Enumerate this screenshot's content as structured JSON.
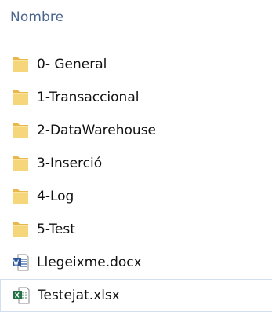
{
  "header": {
    "column_name": "Nombre"
  },
  "colors": {
    "header_text": "#4a6690",
    "folder_body": "#f6d67b",
    "folder_tab": "#e8b84a",
    "word_blue": "#2b579a",
    "excel_green": "#217346",
    "selection_border": "#d3dff0"
  },
  "files": [
    {
      "name": "0- General",
      "icon": "folder-icon",
      "selected": false
    },
    {
      "name": "1-Transaccional",
      "icon": "folder-icon",
      "selected": false
    },
    {
      "name": "2-DataWarehouse",
      "icon": "folder-icon",
      "selected": false
    },
    {
      "name": "3-Inserció",
      "icon": "folder-icon",
      "selected": false
    },
    {
      "name": "4-Log",
      "icon": "folder-icon",
      "selected": false
    },
    {
      "name": "5-Test",
      "icon": "folder-icon",
      "selected": false
    },
    {
      "name": "Llegeixme.docx",
      "icon": "word-document-icon",
      "selected": false
    },
    {
      "name": "Testejat.xlsx",
      "icon": "excel-spreadsheet-icon",
      "selected": true
    }
  ]
}
